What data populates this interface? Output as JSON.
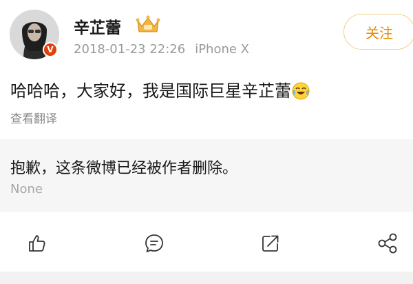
{
  "post": {
    "username": "辛芷蕾",
    "date": "2018-01-23 22:26",
    "device": "iPhone X",
    "follow_label": "关注",
    "text": "哈哈哈，大家好，我是国际巨星辛芷蕾",
    "emoji": "laughing-crying-emoji",
    "translate_label": "查看翻译",
    "verified_badge": "V"
  },
  "repost": {
    "deleted_text": "抱歉，这条微博已经被作者删除。",
    "source": "None"
  },
  "actions": [
    {
      "icon": "like-icon"
    },
    {
      "icon": "comment-icon"
    },
    {
      "icon": "repost-icon"
    },
    {
      "icon": "share-icon"
    }
  ],
  "colors": {
    "follow_text": "#e58a00",
    "follow_border": "#f0cf87",
    "verified_badge": "#e3400c",
    "muted_text": "#9a9a9a",
    "deleted_bg": "#f6f6f6"
  }
}
